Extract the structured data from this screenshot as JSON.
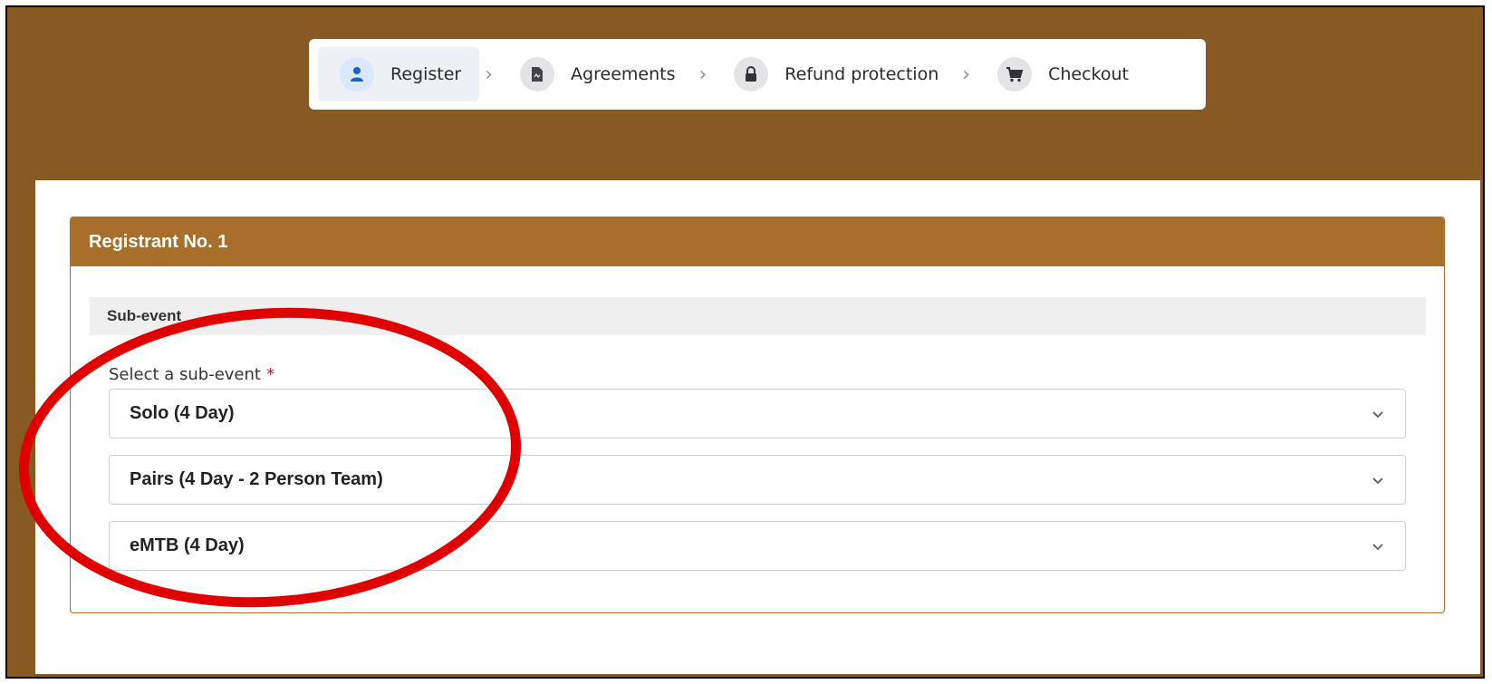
{
  "stepper": {
    "steps": [
      {
        "label": "Register",
        "icon": "user-icon",
        "active": true
      },
      {
        "label": "Agreements",
        "icon": "document-icon",
        "active": false
      },
      {
        "label": "Refund protection",
        "icon": "lock-icon",
        "active": false
      },
      {
        "label": "Checkout",
        "icon": "cart-icon",
        "active": false
      }
    ],
    "separator": "›"
  },
  "registrant": {
    "title": "Registrant No. 1",
    "section": "Sub-event",
    "field_label": "Select a sub-event",
    "required_mark": "*",
    "selects": [
      {
        "value": "Solo (4 Day)"
      },
      {
        "value": "Pairs (4 Day - 2 Person Team)"
      },
      {
        "value": "eMTB (4 Day)"
      }
    ]
  },
  "colors": {
    "background": "#865a22",
    "header": "#a86f2b",
    "annotation_circle": "#e00000",
    "active_icon": "#1565c0"
  }
}
